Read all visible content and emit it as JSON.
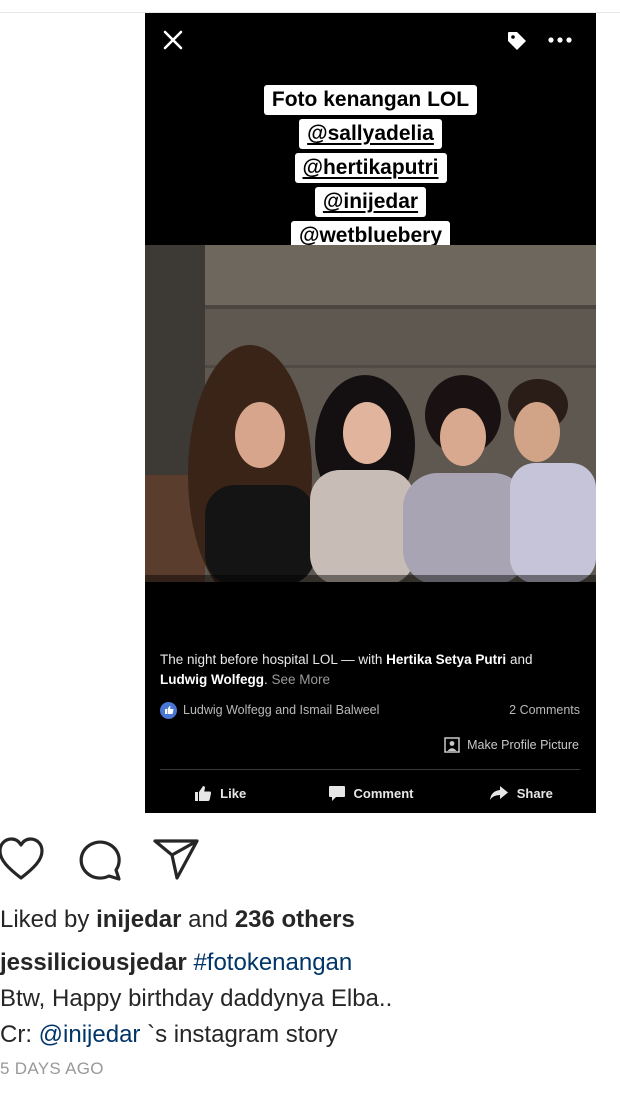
{
  "story": {
    "caption_lines": [
      "Foto kenangan LOL",
      "@sallyadelia",
      "@hertikaputri",
      "@inijedar",
      "@wetbluebery"
    ],
    "icons": {
      "close": "close-icon",
      "tag": "tag-icon",
      "more": "more-horizontal-icon"
    },
    "fb_caption": {
      "text_before": "The night before hospital LOL — with ",
      "person1": "Hertika Setya Putri",
      "and_text": " and ",
      "person2": "Ludwig Wolfegg",
      "period": ".",
      "see_more": "See More"
    },
    "reactions_text": "Ludwig Wolfegg and Ismail Balweel",
    "comments_count": "2 Comments",
    "make_profile_label": "Make Profile Picture",
    "actions": {
      "like": "Like",
      "comment": "Comment",
      "share": "Share"
    }
  },
  "instagram": {
    "icons": [
      "heart-icon",
      "comment-icon",
      "share-direct-icon"
    ],
    "likes": {
      "prefix": "Liked by ",
      "user": "inijedar",
      "mid": " and ",
      "others": "236 others"
    },
    "caption": {
      "username": "jessiliciousjedar",
      "hashtag": "#fotokenangan",
      "line2": "Btw, Happy birthday daddynya Elba..",
      "line3_prefix": "Cr: ",
      "line3_mention": "@inijedar",
      "line3_suffix": " `s instagram story"
    },
    "timestamp": "5 DAYS AGO"
  },
  "colors": {
    "story_bg": "#000000",
    "link": "#003569",
    "timestamp": "#999999",
    "fb_blue": "#4a76d4"
  }
}
